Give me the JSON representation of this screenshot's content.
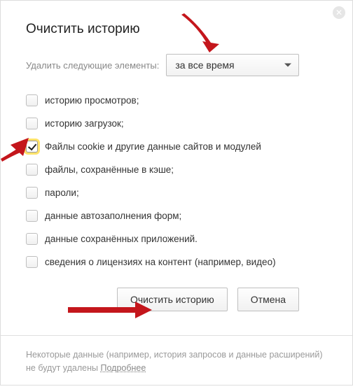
{
  "title": "Очистить историю",
  "time": {
    "label": "Удалить следующие элементы:",
    "selected": "за все время"
  },
  "options": [
    {
      "label": "историю просмотров;",
      "checked": false
    },
    {
      "label": "историю загрузок;",
      "checked": false
    },
    {
      "label": "Файлы cookie и другие данные сайтов и модулей",
      "checked": true
    },
    {
      "label": "файлы, сохранённые в кэше;",
      "checked": false
    },
    {
      "label": "пароли;",
      "checked": false
    },
    {
      "label": "данные автозаполнения форм;",
      "checked": false
    },
    {
      "label": "данные сохранённых приложений.",
      "checked": false
    },
    {
      "label": "сведения о лицензиях на контент (например, видео)",
      "checked": false
    }
  ],
  "buttons": {
    "clear": "Очистить историю",
    "cancel": "Отмена"
  },
  "footer": {
    "text": "Некоторые данные (например, история запросов и данные расширений) не будут удалены ",
    "link": "Подробнее"
  }
}
